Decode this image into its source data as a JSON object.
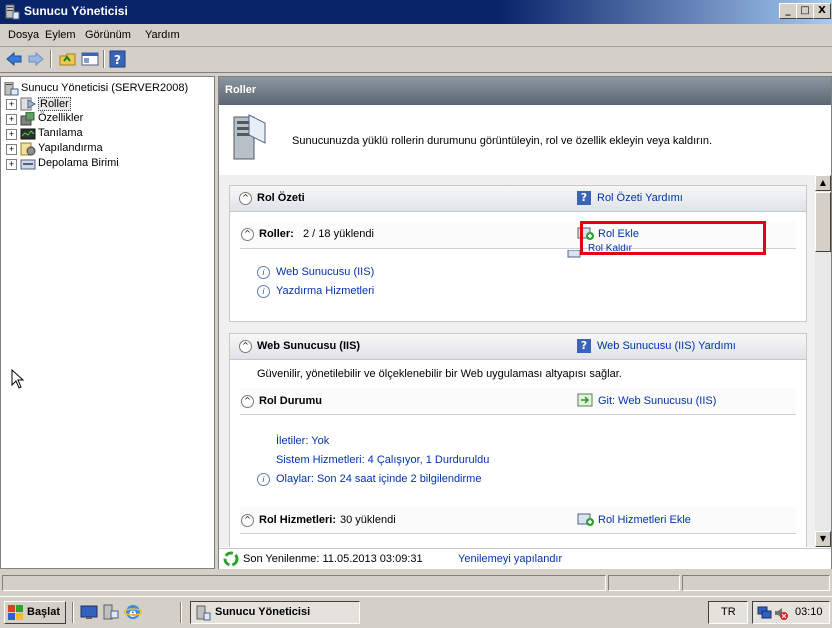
{
  "window": {
    "title": "Sunucu Yöneticisi",
    "min": "_",
    "max": "□",
    "close": "X"
  },
  "menu": [
    "Dosya",
    "Eylem",
    "Görünüm",
    "Yardım"
  ],
  "tree": {
    "root": "Sunucu Yöneticisi (SERVER2008)",
    "items": [
      "Roller",
      "Özellikler",
      "Tanılama",
      "Yapılandırma",
      "Depolama Birimi"
    ]
  },
  "right": {
    "header": "Roller",
    "intro": "Sunucunuzda yüklü rollerin durumunu görüntüleyin, rol ve özellik ekleyin veya kaldırın.",
    "summary": {
      "title": "Rol Özeti",
      "help": "Rol Özeti Yardımı",
      "roles_label": "Roller:",
      "roles_count": "2 / 18 yüklendi",
      "add_role": "Rol Ekle",
      "remove_role": "Rol Kaldır",
      "installed": [
        "Web Sunucusu (IIS)",
        "Yazdırma Hizmetleri"
      ]
    },
    "iis": {
      "title": "Web Sunucusu (IIS)",
      "help": "Web Sunucusu (IIS) Yardımı",
      "desc": "Güvenilir, yönetilebilir ve ölçeklenebilir bir Web uygulaması altyapısı sağlar.",
      "status_title": "Rol Durumu",
      "goto": "Git: Web Sunucusu (IIS)",
      "messages": "İletiler: Yok",
      "services": "Sistem Hizmetleri: 4 Çalışıyor, 1 Durduruldu",
      "events": "Olaylar: Son 24 saat içinde 2 bilgilendirme",
      "services_title": "Rol Hizmetleri:",
      "services_count": "30 yüklendi",
      "add_services": "Rol Hizmetleri Ekle"
    },
    "status": {
      "refresh": "Son Yenilenme: 11.05.2013 03:09:31",
      "configure": "Yenilemeyi yapılandır"
    }
  },
  "taskbar": {
    "start": "Başlat",
    "task": "Sunucu Yöneticisi",
    "lang": "TR",
    "time": "03:10"
  }
}
